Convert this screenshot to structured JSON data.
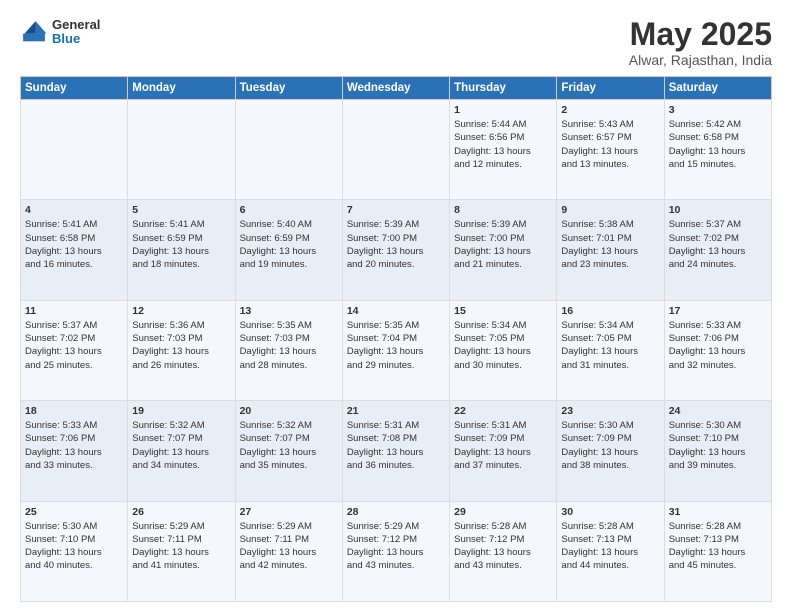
{
  "header": {
    "logo_general": "General",
    "logo_blue": "Blue",
    "month_year": "May 2025",
    "location": "Alwar, Rajasthan, India"
  },
  "days_of_week": [
    "Sunday",
    "Monday",
    "Tuesday",
    "Wednesday",
    "Thursday",
    "Friday",
    "Saturday"
  ],
  "weeks": [
    [
      {
        "day": "",
        "text": ""
      },
      {
        "day": "",
        "text": ""
      },
      {
        "day": "",
        "text": ""
      },
      {
        "day": "",
        "text": ""
      },
      {
        "day": "1",
        "text": "Sunrise: 5:44 AM\nSunset: 6:56 PM\nDaylight: 13 hours\nand 12 minutes."
      },
      {
        "day": "2",
        "text": "Sunrise: 5:43 AM\nSunset: 6:57 PM\nDaylight: 13 hours\nand 13 minutes."
      },
      {
        "day": "3",
        "text": "Sunrise: 5:42 AM\nSunset: 6:58 PM\nDaylight: 13 hours\nand 15 minutes."
      }
    ],
    [
      {
        "day": "4",
        "text": "Sunrise: 5:41 AM\nSunset: 6:58 PM\nDaylight: 13 hours\nand 16 minutes."
      },
      {
        "day": "5",
        "text": "Sunrise: 5:41 AM\nSunset: 6:59 PM\nDaylight: 13 hours\nand 18 minutes."
      },
      {
        "day": "6",
        "text": "Sunrise: 5:40 AM\nSunset: 6:59 PM\nDaylight: 13 hours\nand 19 minutes."
      },
      {
        "day": "7",
        "text": "Sunrise: 5:39 AM\nSunset: 7:00 PM\nDaylight: 13 hours\nand 20 minutes."
      },
      {
        "day": "8",
        "text": "Sunrise: 5:39 AM\nSunset: 7:00 PM\nDaylight: 13 hours\nand 21 minutes."
      },
      {
        "day": "9",
        "text": "Sunrise: 5:38 AM\nSunset: 7:01 PM\nDaylight: 13 hours\nand 23 minutes."
      },
      {
        "day": "10",
        "text": "Sunrise: 5:37 AM\nSunset: 7:02 PM\nDaylight: 13 hours\nand 24 minutes."
      }
    ],
    [
      {
        "day": "11",
        "text": "Sunrise: 5:37 AM\nSunset: 7:02 PM\nDaylight: 13 hours\nand 25 minutes."
      },
      {
        "day": "12",
        "text": "Sunrise: 5:36 AM\nSunset: 7:03 PM\nDaylight: 13 hours\nand 26 minutes."
      },
      {
        "day": "13",
        "text": "Sunrise: 5:35 AM\nSunset: 7:03 PM\nDaylight: 13 hours\nand 28 minutes."
      },
      {
        "day": "14",
        "text": "Sunrise: 5:35 AM\nSunset: 7:04 PM\nDaylight: 13 hours\nand 29 minutes."
      },
      {
        "day": "15",
        "text": "Sunrise: 5:34 AM\nSunset: 7:05 PM\nDaylight: 13 hours\nand 30 minutes."
      },
      {
        "day": "16",
        "text": "Sunrise: 5:34 AM\nSunset: 7:05 PM\nDaylight: 13 hours\nand 31 minutes."
      },
      {
        "day": "17",
        "text": "Sunrise: 5:33 AM\nSunset: 7:06 PM\nDaylight: 13 hours\nand 32 minutes."
      }
    ],
    [
      {
        "day": "18",
        "text": "Sunrise: 5:33 AM\nSunset: 7:06 PM\nDaylight: 13 hours\nand 33 minutes."
      },
      {
        "day": "19",
        "text": "Sunrise: 5:32 AM\nSunset: 7:07 PM\nDaylight: 13 hours\nand 34 minutes."
      },
      {
        "day": "20",
        "text": "Sunrise: 5:32 AM\nSunset: 7:07 PM\nDaylight: 13 hours\nand 35 minutes."
      },
      {
        "day": "21",
        "text": "Sunrise: 5:31 AM\nSunset: 7:08 PM\nDaylight: 13 hours\nand 36 minutes."
      },
      {
        "day": "22",
        "text": "Sunrise: 5:31 AM\nSunset: 7:09 PM\nDaylight: 13 hours\nand 37 minutes."
      },
      {
        "day": "23",
        "text": "Sunrise: 5:30 AM\nSunset: 7:09 PM\nDaylight: 13 hours\nand 38 minutes."
      },
      {
        "day": "24",
        "text": "Sunrise: 5:30 AM\nSunset: 7:10 PM\nDaylight: 13 hours\nand 39 minutes."
      }
    ],
    [
      {
        "day": "25",
        "text": "Sunrise: 5:30 AM\nSunset: 7:10 PM\nDaylight: 13 hours\nand 40 minutes."
      },
      {
        "day": "26",
        "text": "Sunrise: 5:29 AM\nSunset: 7:11 PM\nDaylight: 13 hours\nand 41 minutes."
      },
      {
        "day": "27",
        "text": "Sunrise: 5:29 AM\nSunset: 7:11 PM\nDaylight: 13 hours\nand 42 minutes."
      },
      {
        "day": "28",
        "text": "Sunrise: 5:29 AM\nSunset: 7:12 PM\nDaylight: 13 hours\nand 43 minutes."
      },
      {
        "day": "29",
        "text": "Sunrise: 5:28 AM\nSunset: 7:12 PM\nDaylight: 13 hours\nand 43 minutes."
      },
      {
        "day": "30",
        "text": "Sunrise: 5:28 AM\nSunset: 7:13 PM\nDaylight: 13 hours\nand 44 minutes."
      },
      {
        "day": "31",
        "text": "Sunrise: 5:28 AM\nSunset: 7:13 PM\nDaylight: 13 hours\nand 45 minutes."
      }
    ]
  ]
}
